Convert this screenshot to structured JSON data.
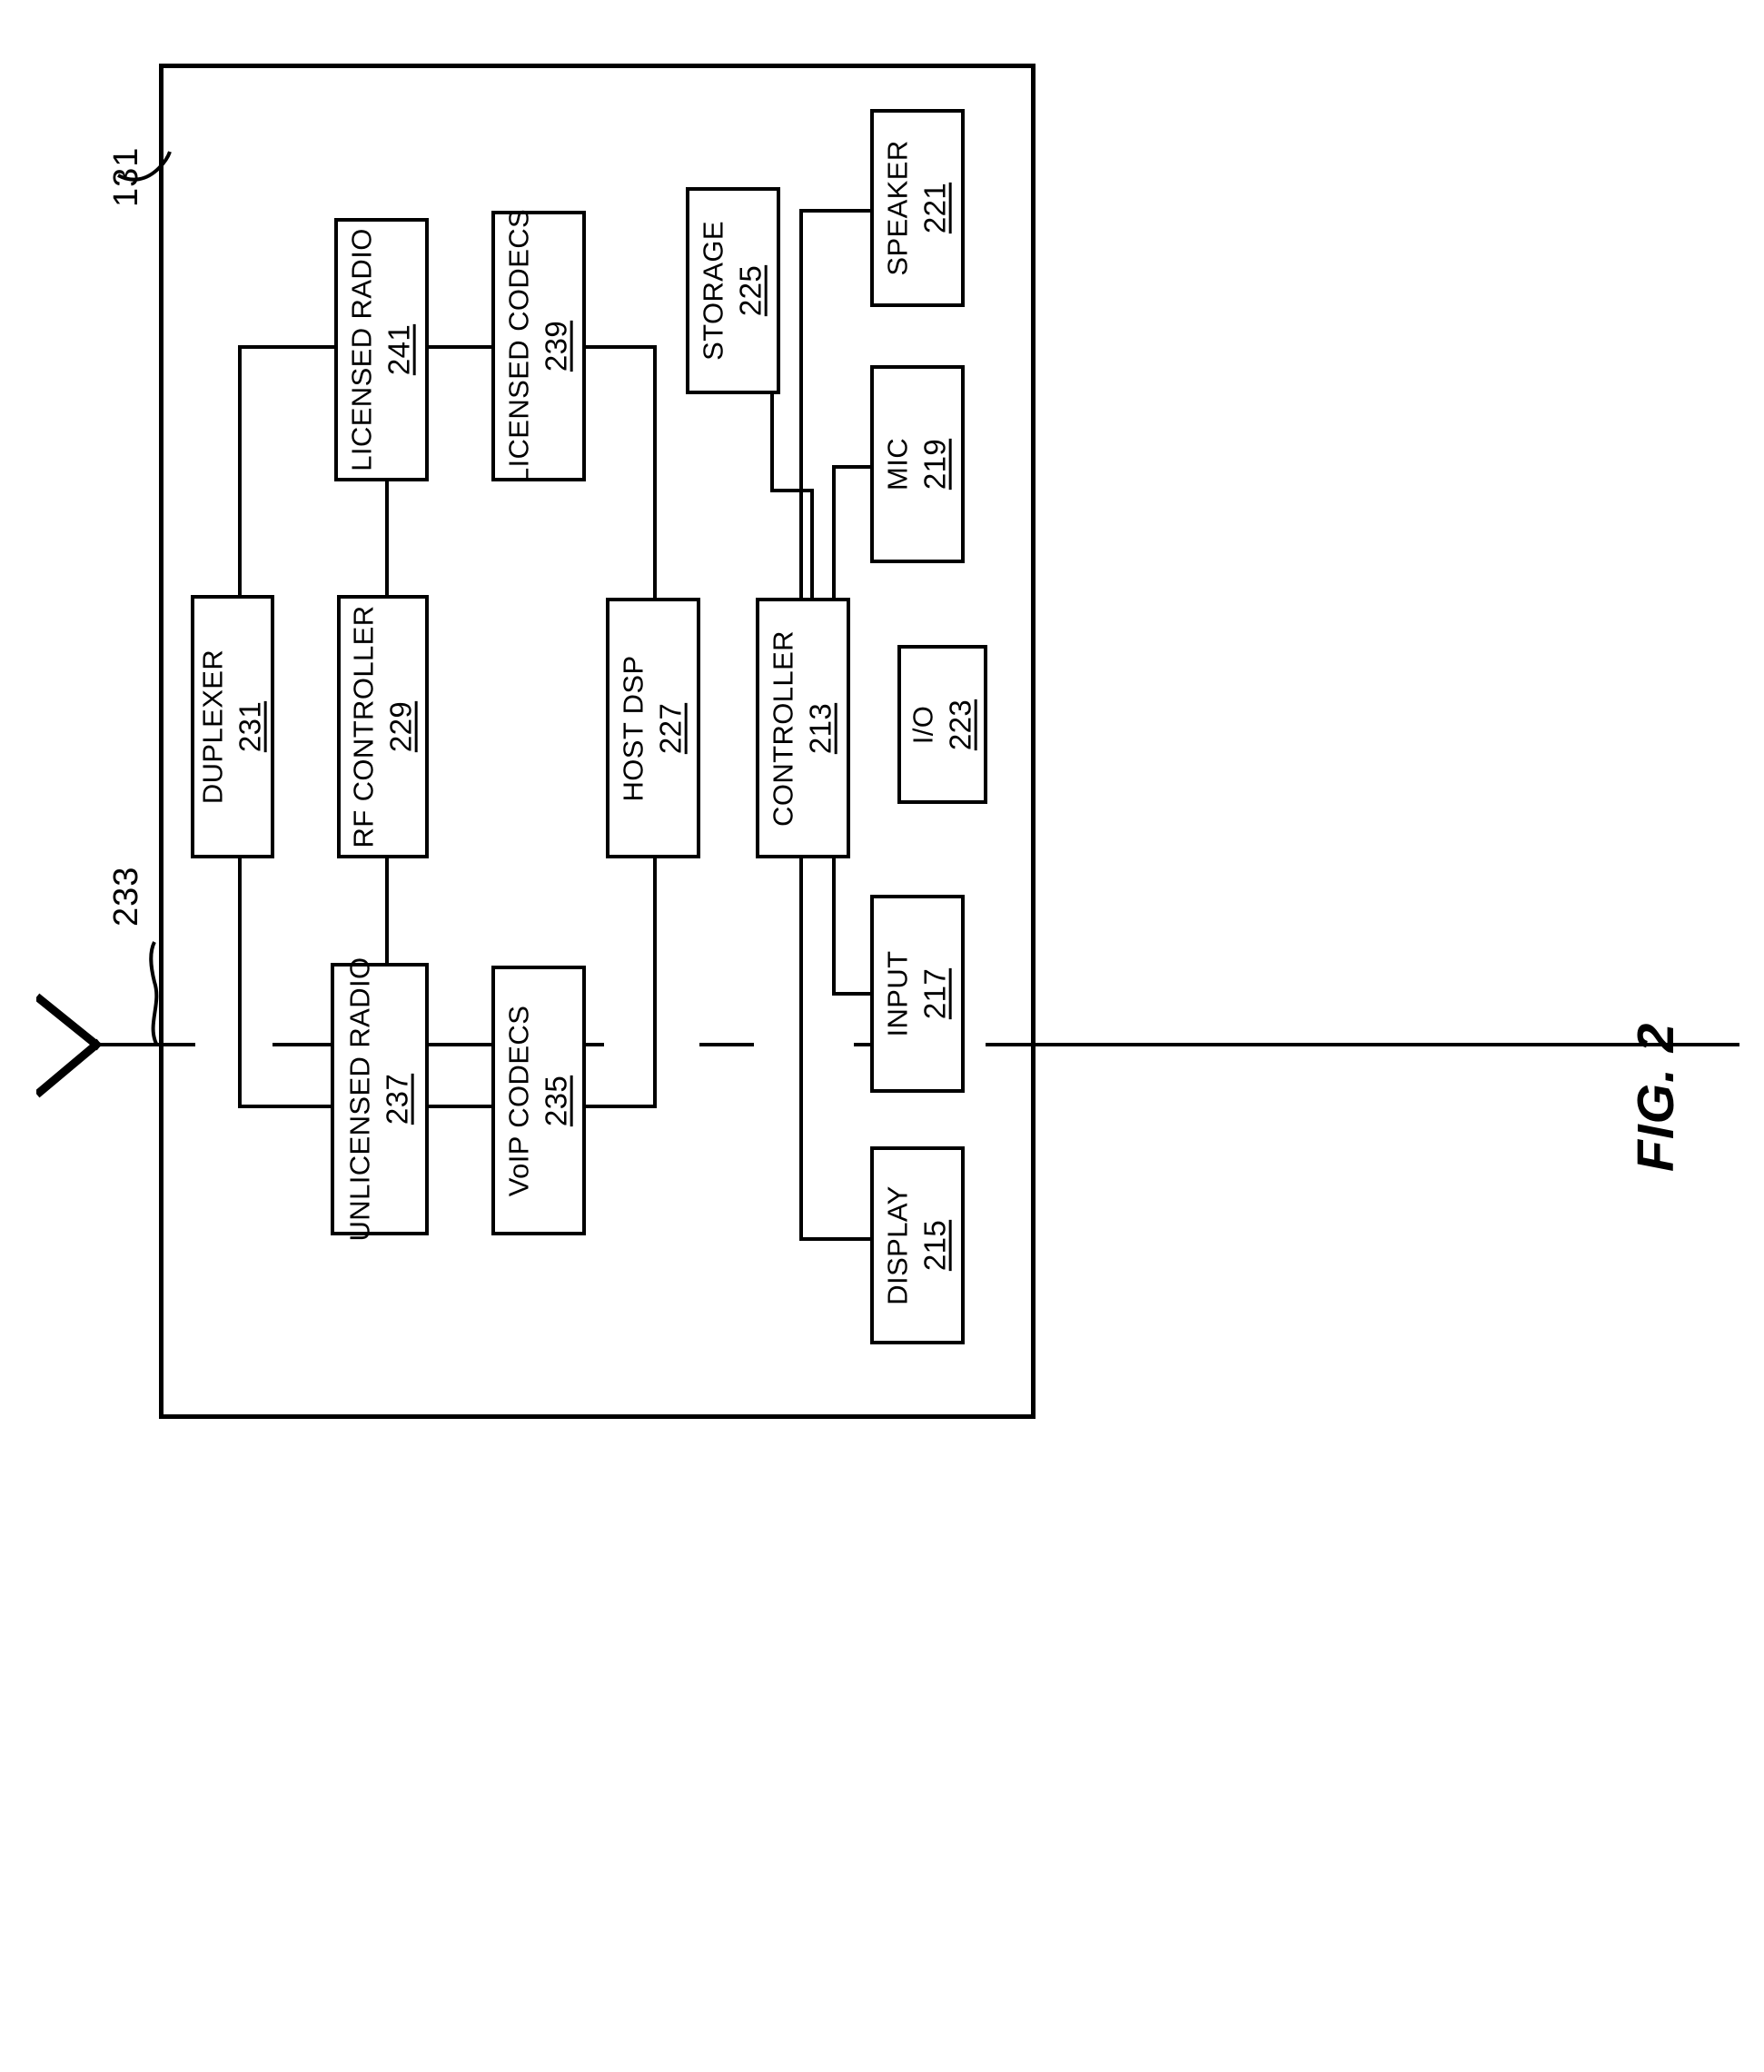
{
  "figure": {
    "caption": "FIG. 2",
    "device_ref": "131",
    "antenna_ref": "233"
  },
  "blocks": [
    {
      "id": "licensed-radio",
      "name": "LICENSED RADIO",
      "num": "241"
    },
    {
      "id": "licensed-codecs",
      "name": "LICENSED CODECS",
      "num": "239"
    },
    {
      "id": "storage",
      "name": "STORAGE",
      "num": "225"
    },
    {
      "id": "speaker",
      "name": "SPEAKER",
      "num": "221"
    },
    {
      "id": "mic",
      "name": "MIC",
      "num": "219"
    },
    {
      "id": "duplexer",
      "name": "DUPLEXER",
      "num": "231"
    },
    {
      "id": "rf-controller",
      "name": "RF CONTROLLER",
      "num": "229"
    },
    {
      "id": "host-dsp",
      "name": "HOST DSP",
      "num": "227"
    },
    {
      "id": "controller",
      "name": "CONTROLLER",
      "num": "213"
    },
    {
      "id": "io",
      "name": "I/O",
      "num": "223"
    },
    {
      "id": "unlicensed-radio",
      "name": "UNLICENSED RADIO",
      "num": "237"
    },
    {
      "id": "voip-codecs",
      "name": "VoIP CODECS",
      "num": "235"
    },
    {
      "id": "input",
      "name": "INPUT",
      "num": "217"
    },
    {
      "id": "display",
      "name": "DISPLAY",
      "num": "215"
    }
  ]
}
